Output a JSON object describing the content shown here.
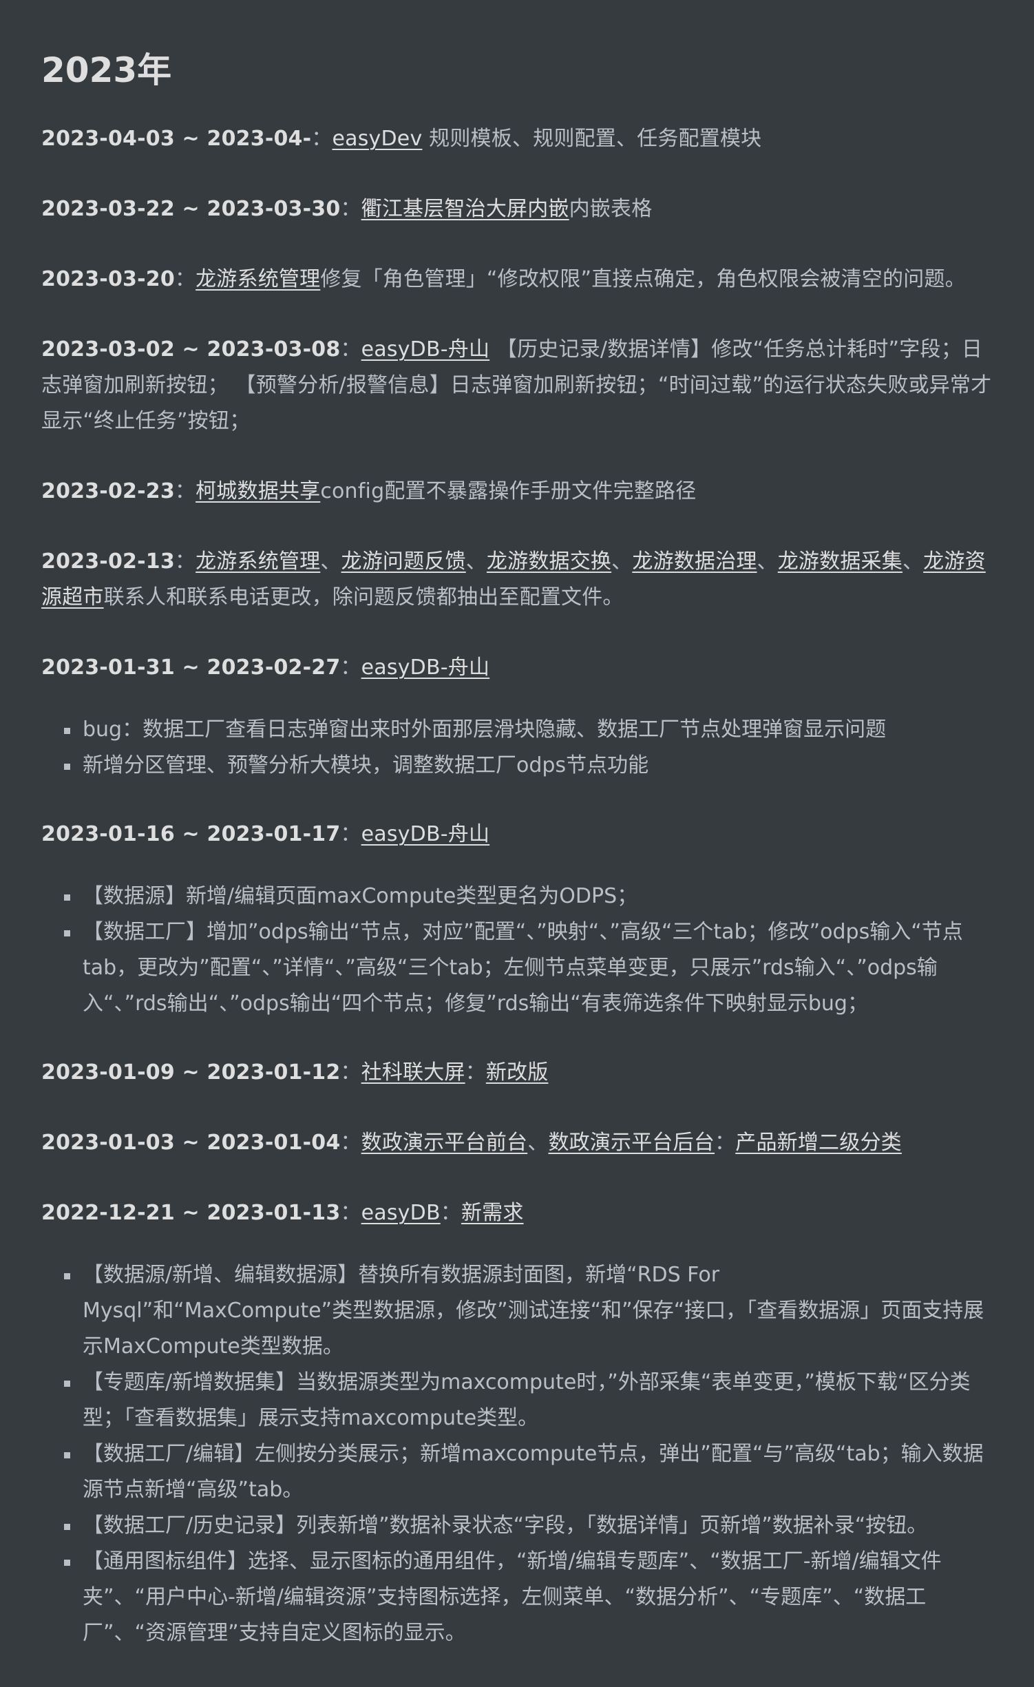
{
  "heading": "2023年",
  "sep": "：",
  "comma": "、",
  "entries": [
    {
      "date": "2023-04-03 ~ 2023-04-",
      "link1": "easyDev",
      "text": " 规则模板、规则配置、任务配置模块"
    },
    {
      "date": "2023-03-22 ~ 2023-03-30",
      "link1": "衢江基层智治大屏内嵌",
      "text": "内嵌表格"
    },
    {
      "date": "2023-03-20",
      "link1": "龙游系统管理",
      "text": "修复「角色管理」“修改权限”直接点确定，角色权限会被清空的问题。"
    },
    {
      "date": "2023-03-02 ~ 2023-03-08",
      "link1": "easyDB-舟山",
      "text": " 【历史记录/数据详情】修改“任务总计耗时”字段；日志弹窗加刷新按钮；  【预警分析/报警信息】日志弹窗加刷新按钮；“时间过载”的运行状态失败或异常才显示“终止任务”按钮；"
    },
    {
      "date": "2023-02-23",
      "link1": "柯城数据共享",
      "text": "config配置不暴露操作手册文件完整路径"
    },
    {
      "date": "2023-02-13",
      "links": [
        "龙游系统管理",
        "龙游问题反馈",
        "龙游数据交换",
        "龙游数据治理",
        "龙游数据采集",
        "龙游资源超市"
      ],
      "text": "联系人和联系电话更改，除问题反馈都抽出至配置文件。"
    },
    {
      "date": "2023-01-31 ~ 2023-02-27",
      "link1": "easyDB-舟山",
      "items": [
        "bug：数据工厂查看日志弹窗出来时外面那层滑块隐藏、数据工厂节点处理弹窗显示问题",
        "新增分区管理、预警分析大模块，调整数据工厂odps节点功能"
      ]
    },
    {
      "date": "2023-01-16 ~ 2023-01-17",
      "link1": "easyDB-舟山",
      "items": [
        "【数据源】新增/编辑页面maxCompute类型更名为ODPS；",
        "【数据工厂】增加”odps输出“节点，对应”配置“、”映射“、”高级“三个tab；修改”odps输入“节点tab，更改为”配置“、”详情“、”高级“三个tab；左侧节点菜单变更，只展示”rds输入“、”odps输入“、”rds输出“、”odps输出“四个节点；修复”rds输出“有表筛选条件下映射显示bug；"
      ]
    },
    {
      "date": "2023-01-09 ~ 2023-01-12",
      "link1": "社科联大屏",
      "link2": "新改版"
    },
    {
      "date": "2023-01-03 ~ 2023-01-04",
      "link1": "数政演示平台前台",
      "link1b": "数政演示平台后台",
      "link2": "产品新增二级分类"
    },
    {
      "date": "2022-12-21 ~ 2023-01-13",
      "link1": "easyDB",
      "link2": "新需求",
      "items": [
        "【数据源/新增、编辑数据源】替换所有数据源封面图，新增“RDS For Mysql”和“MaxCompute”类型数据源，修改”测试连接“和”保存“接口，「查看数据源」页面支持展示MaxCompute类型数据。",
        "【专题库/新增数据集】当数据源类型为maxcompute时，”外部采集“表单变更，”模板下载“区分类型；「查看数据集」展示支持maxcompute类型。",
        "【数据工厂/编辑】左侧按分类展示；新增maxcompute节点，弹出”配置“与”高级“tab；输入数据源节点新增“高级”tab。",
        "【数据工厂/历史记录】列表新增”数据补录状态“字段，「数据详情」页新增”数据补录“按钮。",
        "【通用图标组件】选择、显示图标的通用组件，“新增/编辑专题库”、“数据工厂-新增/编辑文件夹”、“用户中心-新增/编辑资源”支持图标选择，左侧菜单、“数据分析”、“专题库”、“数据工厂”、“资源管理”支持自定义图标的显示。"
      ]
    }
  ]
}
